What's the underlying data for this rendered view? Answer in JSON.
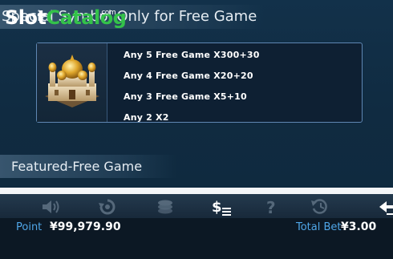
{
  "watermark": {
    "slot": "Slot",
    "catalog": "Catalog",
    "com": ".com"
  },
  "section": {
    "title": "Special Symbol Only for Free Game",
    "payouts": [
      {
        "text": "Any 5  Free Game X300+30"
      },
      {
        "text": "Any 4  Free Game X20+20"
      },
      {
        "text": "Any 3  Free Game X5+10"
      },
      {
        "text": "Any 2  X2"
      }
    ]
  },
  "featured": {
    "title": "Featured-Free Game"
  },
  "toolbar": {
    "buttons": [
      {
        "name": "sound-icon"
      },
      {
        "name": "autoplay-icon"
      },
      {
        "name": "coins-icon"
      },
      {
        "name": "paytable-icon",
        "active": true
      },
      {
        "name": "help-icon"
      },
      {
        "name": "history-icon"
      },
      {
        "name": "back-arrow-icon",
        "active": true
      }
    ]
  },
  "status": {
    "point_label": "Point",
    "point_value": "¥99,979.90",
    "bet_label": "Total Bet",
    "bet_value": "¥3.00"
  },
  "colors": {
    "accent": "#4fa6e8",
    "panel": "#0f2a3f",
    "border": "#5f87b3",
    "watermark_green": "#34c24a"
  }
}
